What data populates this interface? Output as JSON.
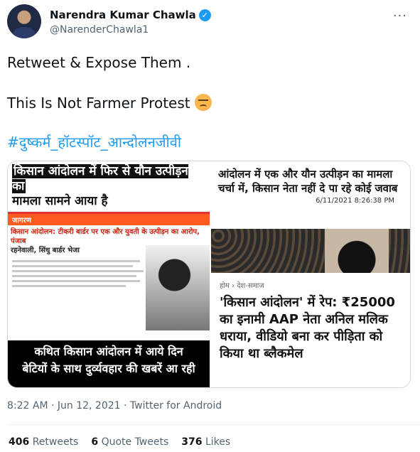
{
  "author": {
    "name": "Narendra Kumar Chawla",
    "handle": "@NarenderChawla1"
  },
  "tweet": {
    "line1": "Retweet & Expose Them .",
    "line2": "This Is Not Farmer Protest",
    "hashtag": "#दुष्कर्म_हॉटस्पॉट_आन्दोलनजीवी"
  },
  "media": {
    "left_headline_1": "किसान आंदोलन में फिर से यौन उत्पीड़न का",
    "left_headline_2": "मामला सामने आया है",
    "left_brand": "जागरण",
    "left_sub_1": "किसान आंदोलन: टीकरी बार्डर पर एक और युवती के उत्पीड़न का आरोप, पंजाब",
    "left_sub_2": "रहनेवाली, सिंधु बार्डर भेजा",
    "left_footer_1": "कथित किसान आंदोलन में आये दिन",
    "left_footer_2": "बेटियों के साथ दुर्व्यवहार की खबरें आ रही",
    "right_top_headline": "आंदोलन में एक और यौन उत्पीड़न का मामला चर्चा में, किसान नेता नहीं दे पा रहे कोई जवाब",
    "right_top_timestamp": "6/11/2021 8:26:38 PM",
    "right_bottom_crumb": "होम › देश-समाज",
    "right_bottom_title": "'किसान आंदोलन' में रेप: ₹25000 का इनामी AAP नेता अनिल मलिक धराया, वीडियो बना कर पीड़िता को किया था ब्लैकमेल"
  },
  "meta": "8:22 AM · Jun 12, 2021 · Twitter for Android",
  "stats": {
    "retweets_count": "406",
    "retweets_label": "Retweets",
    "quotes_count": "6",
    "quotes_label": "Quote Tweets",
    "likes_count": "376",
    "likes_label": "Likes"
  },
  "icons": {
    "verified": "verified-badge-icon",
    "more": "more-options-icon",
    "emoji": "angry-face-emoji"
  },
  "colors": {
    "link": "#1d9bf0",
    "secondary": "#536471",
    "verified": "#1d9bf0"
  }
}
